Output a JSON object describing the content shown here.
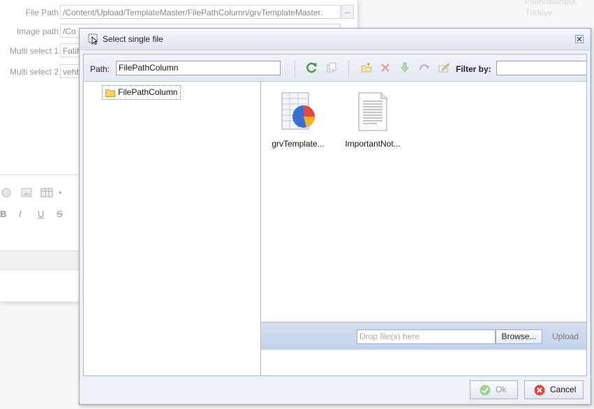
{
  "background_form": {
    "rows": [
      {
        "label": "File Path",
        "value": "/Content/Upload/TemplateMaster/FilePathColumn/grvTemplateMaster.",
        "button": "..."
      },
      {
        "label": "Image path",
        "value": "/Co",
        "button": ""
      },
      {
        "label": "Multi select 1",
        "value": "Fatih",
        "button": ""
      },
      {
        "label": "Multi select 2",
        "value": "vehb",
        "button": ""
      }
    ],
    "address_line1": "Fatih/İstanbul,",
    "address_line2": "Türkiye",
    "editor": {
      "bold": "B",
      "italic": "I",
      "underline": "U",
      "strike": "S"
    }
  },
  "dialog": {
    "title": "Select single file",
    "path_label": "Path:",
    "path_value": "FilePathColumn",
    "filter_label": "Filter by:",
    "filter_value": "",
    "tree": {
      "root": "FilePathColumn"
    },
    "files": [
      {
        "name": "grvTemplate...",
        "icon": "spreadsheet-chart-icon"
      },
      {
        "name": "ImportantNot...",
        "icon": "text-document-icon"
      }
    ],
    "upload": {
      "drop_placeholder": "Drop file(s) here",
      "browse_label": "Browse...",
      "upload_label": "Upload"
    },
    "buttons": {
      "ok": "Ok",
      "cancel": "Cancel"
    },
    "colors": {
      "accent": "#8c9fc0",
      "refresh": "#3c9a3c",
      "delete": "#d9534f"
    }
  }
}
